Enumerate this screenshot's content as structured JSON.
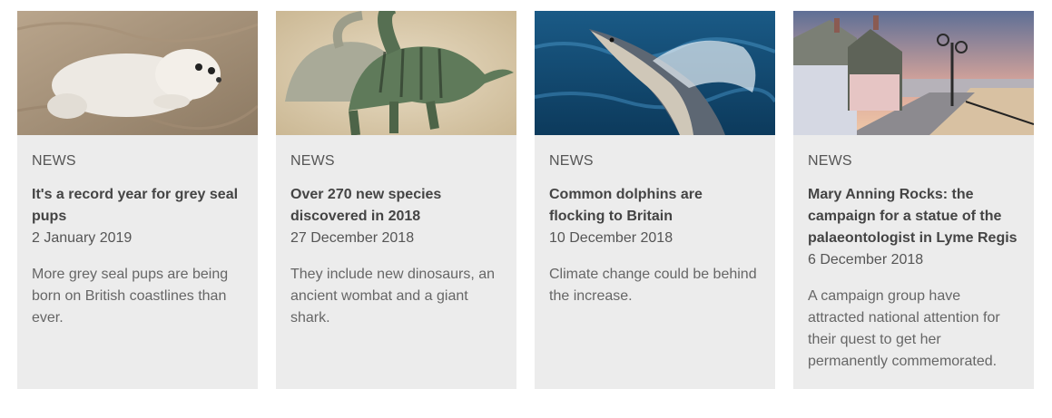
{
  "cards": [
    {
      "image": "grey-seal-pup-photo",
      "label": "NEWS",
      "title": "It's a record year for grey seal pups",
      "date": "2 January 2019",
      "description": "More grey seal pups are being born on British coastlines than ever."
    },
    {
      "image": "dinosaur-illustration",
      "label": "NEWS",
      "title": "Over 270 new species discovered in 2018",
      "date": "27 December 2018",
      "description": "They include new dinosaurs, an ancient wombat and a giant shark."
    },
    {
      "image": "dolphin-photo",
      "label": "NEWS",
      "title": "Common dolphins are flocking to Britain",
      "date": "10 December 2018",
      "description": "Climate change could be behind the increase."
    },
    {
      "image": "lyme-regis-seafront-photo",
      "label": "NEWS",
      "title": "Mary Anning Rocks: the campaign for a statue of the palaeontologist in Lyme Regis",
      "date": "6 December 2018",
      "description": "A campaign group have attracted national attention for their quest to get her permanently commemorated."
    }
  ]
}
